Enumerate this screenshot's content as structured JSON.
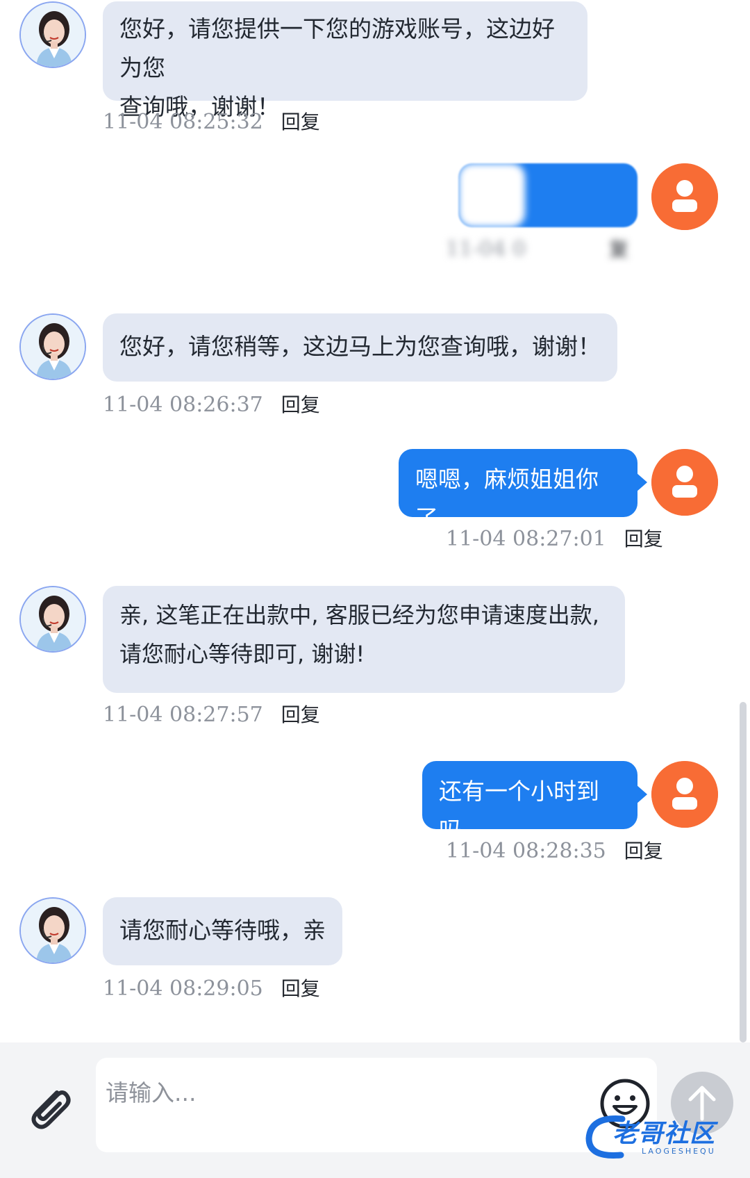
{
  "colors": {
    "agent_bubble": "#e3e8f3",
    "user_bubble": "#1e7ef0",
    "user_avatar": "#f86c35",
    "timestamp": "#8d929b",
    "footer_bg": "#f3f4f6",
    "send_button": "#c9ccd2",
    "watermark": "#1d6fe0"
  },
  "icons": {
    "agent_avatar": "agent-portrait-icon",
    "user_avatar": "user-silhouette-icon",
    "attach": "paperclip-icon",
    "emoji": "smiley-icon",
    "send": "arrow-up-icon"
  },
  "messages": [
    {
      "sender": "agent",
      "text": "您好，请您提供一下您的游戏账号，这边好为您\n查询哦，谢谢！",
      "time": "11-04 08:25:32",
      "reply": "回复"
    },
    {
      "sender": "user",
      "text": "",
      "time": "11-04 0",
      "reply": "复",
      "redacted": true
    },
    {
      "sender": "agent",
      "text": "您好，请您稍等，这边马上为您查询哦，谢谢！",
      "time": "11-04 08:26:37",
      "reply": "回复"
    },
    {
      "sender": "user",
      "text": "嗯嗯，麻烦姐姐你了",
      "time": "11-04 08:27:01",
      "reply": "回复"
    },
    {
      "sender": "agent",
      "text": "亲, 这笔正在出款中, 客服已经为您申请速度出款,\n请您耐心等待即可, 谢谢!",
      "time": "11-04 08:27:57",
      "reply": "回复"
    },
    {
      "sender": "user",
      "text": "还有一个小时到吗",
      "time": "11-04 08:28:35",
      "reply": "回复"
    },
    {
      "sender": "agent",
      "text": "请您耐心等待哦，亲",
      "time": "11-04 08:29:05",
      "reply": "回复"
    }
  ],
  "composer": {
    "placeholder": "请输入..."
  },
  "watermark": {
    "text": "老哥社区",
    "subtext": "LAOGESHEQU"
  }
}
